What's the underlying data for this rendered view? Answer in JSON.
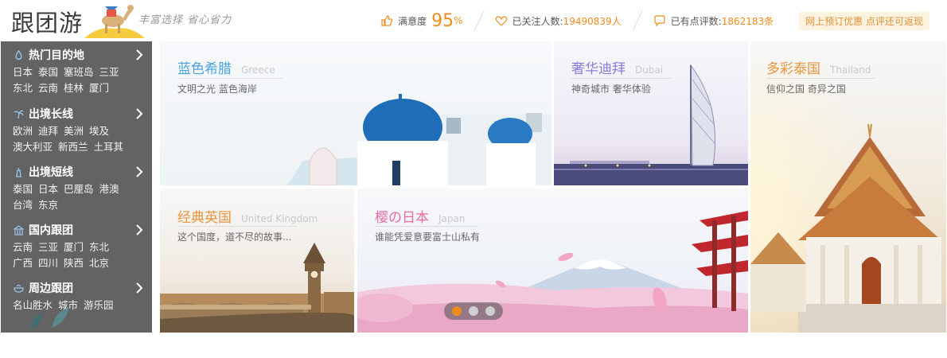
{
  "header": {
    "logo_text": "跟团游",
    "slogan": "丰富选择 省心省力",
    "satisfaction_label": "满意度",
    "satisfaction_value": "95",
    "satisfaction_unit": "%",
    "followers_label": "已关注人数:",
    "followers_value": "19490839人",
    "reviews_label": "已有点评数:",
    "reviews_value": "1862183条",
    "promo": "网上预订优惠 点评还可返现",
    "accent_color": "#f08c1e"
  },
  "sidebar": {
    "groups": [
      {
        "title": "热门目的地",
        "icon": "drop-icon",
        "links": [
          "日本",
          "泰国",
          "塞班岛",
          "三亚",
          "东北",
          "云南",
          "桂林",
          "厦门"
        ]
      },
      {
        "title": "出境长线",
        "icon": "palm-tree-icon",
        "links": [
          "欧洲",
          "迪拜",
          "美洲",
          "埃及",
          "澳大利亚",
          "新西兰",
          "土耳其"
        ]
      },
      {
        "title": "出境短线",
        "icon": "tower-icon",
        "links": [
          "泰国",
          "日本",
          "巴厘岛",
          "港澳",
          "台湾",
          "东京"
        ]
      },
      {
        "title": "国内跟团",
        "icon": "landmark-icon",
        "links": [
          "云南",
          "三亚",
          "厦门",
          "东北",
          "广西",
          "四川",
          "陕西",
          "北京"
        ]
      },
      {
        "title": "周边跟团",
        "icon": "teacup-icon",
        "links": [
          "名山胜水",
          "城市",
          "游乐园"
        ]
      }
    ]
  },
  "banners": {
    "greece": {
      "title": "蓝色希腊",
      "en": "Greece",
      "sub": "文明之光 蓝色海岸",
      "color": "#4aa3df"
    },
    "dubai": {
      "title": "奢华迪拜",
      "en": "Dubai",
      "sub": "神奇城市 奢华体验",
      "color": "#8b7bd8"
    },
    "thailand": {
      "title": "多彩泰国",
      "en": "Thailand",
      "sub": "信仰之国 奇异之国",
      "color": "#e8943a"
    },
    "uk": {
      "title": "经典英国",
      "en": "United Kingdom",
      "sub": "这个国度，道不尽的故事...",
      "color": "#e8943a"
    },
    "japan": {
      "title": "樱の日本",
      "en": "Japan",
      "sub": "谁能凭爱意要富士山私有",
      "color": "#e86aa6"
    }
  },
  "carousel": {
    "total": 3,
    "active": 1
  }
}
